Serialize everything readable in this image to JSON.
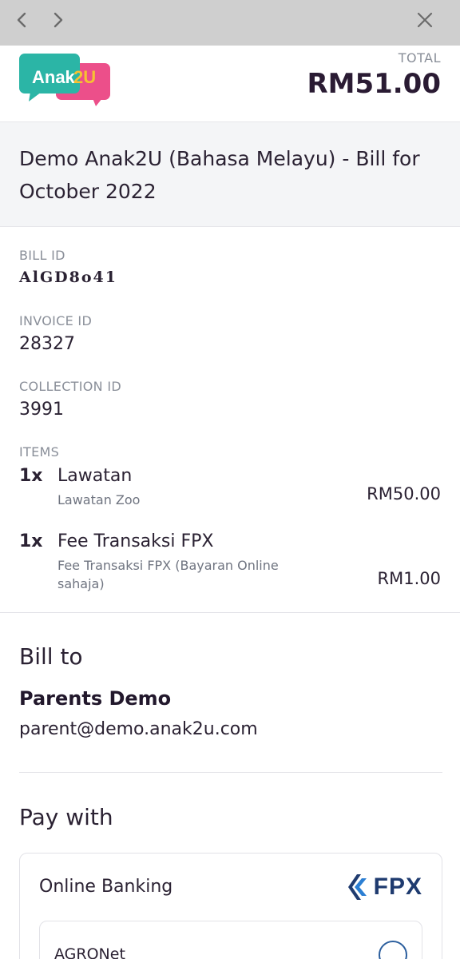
{
  "brand": {
    "name": "Anak2U",
    "logo_text_a": "Anak",
    "logo_text_b": "2U"
  },
  "header": {
    "total_label": "TOTAL",
    "total_amount": "RM51.00"
  },
  "bill": {
    "title": "Demo Anak2U (Bahasa Melayu) - Bill for October 2022",
    "bill_id_label": "BILL ID",
    "bill_id": "AlGD8o41",
    "invoice_id_label": "INVOICE ID",
    "invoice_id": "28327",
    "collection_id_label": "COLLECTION ID",
    "collection_id": "3991",
    "items_label": "ITEMS",
    "items": [
      {
        "qty": "1x",
        "name": "Lawatan",
        "desc": "Lawatan Zoo",
        "price": "RM50.00"
      },
      {
        "qty": "1x",
        "name": "Fee Transaksi FPX",
        "desc": "Fee Transaksi FPX (Bayaran Online sahaja)",
        "price": "RM1.00"
      }
    ]
  },
  "bill_to": {
    "heading": "Bill to",
    "name": "Parents Demo",
    "email": "parent@demo.anak2u.com"
  },
  "pay_with": {
    "heading": "Pay with",
    "method_title": "Online Banking",
    "method_logo_text": "FPX",
    "banks": [
      {
        "name": "AGRONet",
        "selected": false
      }
    ]
  },
  "icons": {
    "back": "chevron-left-icon",
    "forward": "chevron-right-icon",
    "close": "close-icon"
  },
  "colors": {
    "logo_teal": "#2bb5a6",
    "logo_pink": "#ec4f8a",
    "logo_yellow": "#f6c132",
    "fpx_navy": "#1f3b6f",
    "fpx_blue": "#2c7fd3",
    "topbar": "#cfcfcf"
  }
}
